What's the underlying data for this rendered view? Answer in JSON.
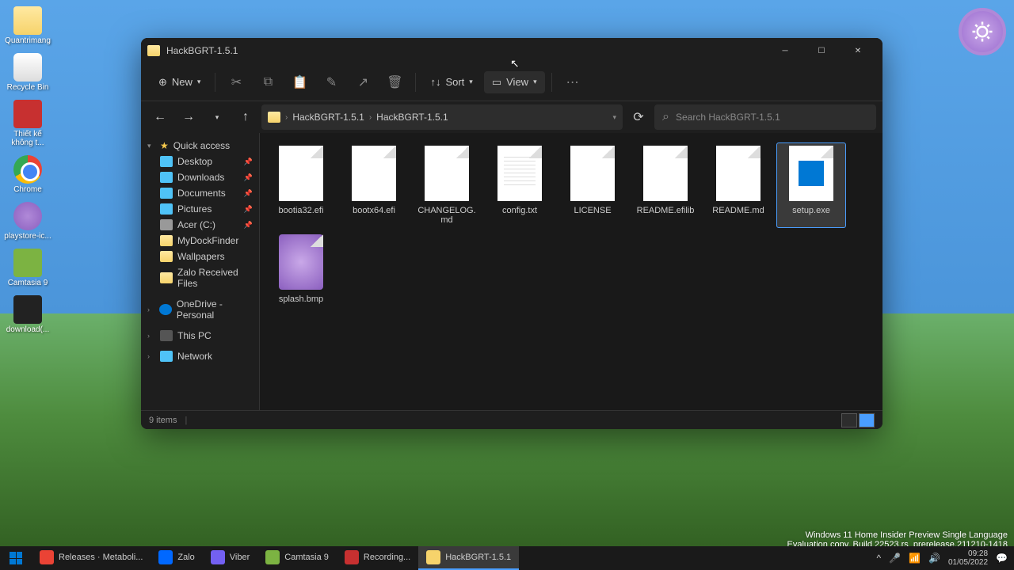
{
  "window": {
    "title": "HackBGRT-1.5.1",
    "toolbar": {
      "new": "New",
      "sort": "Sort",
      "view": "View"
    },
    "breadcrumbs": [
      "HackBGRT-1.5.1",
      "HackBGRT-1.5.1"
    ],
    "search_placeholder": "Search HackBGRT-1.5.1",
    "status": "9 items"
  },
  "sidebar": {
    "quick_access": "Quick access",
    "items": [
      {
        "label": "Desktop",
        "pinned": true
      },
      {
        "label": "Downloads",
        "pinned": true
      },
      {
        "label": "Documents",
        "pinned": true
      },
      {
        "label": "Pictures",
        "pinned": true
      },
      {
        "label": "Acer (C:)",
        "pinned": true
      },
      {
        "label": "MyDockFinder",
        "pinned": false
      },
      {
        "label": "Wallpapers",
        "pinned": false
      },
      {
        "label": "Zalo Received Files",
        "pinned": false
      }
    ],
    "onedrive": "OneDrive - Personal",
    "this_pc": "This PC",
    "network": "Network"
  },
  "files": [
    {
      "name": "bootia32.efi",
      "type": "file"
    },
    {
      "name": "bootx64.efi",
      "type": "file"
    },
    {
      "name": "CHANGELOG.md",
      "type": "file"
    },
    {
      "name": "config.txt",
      "type": "text"
    },
    {
      "name": "LICENSE",
      "type": "file"
    },
    {
      "name": "README.efilib",
      "type": "file"
    },
    {
      "name": "README.md",
      "type": "file"
    },
    {
      "name": "setup.exe",
      "type": "exe",
      "selected": true
    },
    {
      "name": "splash.bmp",
      "type": "bmp"
    }
  ],
  "desktop_icons": [
    {
      "label": "Quantrimang",
      "type": "folder"
    },
    {
      "label": "Recycle Bin",
      "type": "bin"
    },
    {
      "label": "Thiết kế không t...",
      "type": "red"
    },
    {
      "label": "Chrome",
      "type": "chrome"
    },
    {
      "label": "playstore-ic...",
      "type": "purple"
    },
    {
      "label": "Camtasia 9",
      "type": "green"
    },
    {
      "label": "download(...",
      "type": "dark"
    }
  ],
  "taskbar": [
    {
      "label": "Releases · Metaboli...",
      "icon": "chrome"
    },
    {
      "label": "Zalo",
      "icon": "zalo"
    },
    {
      "label": "Viber",
      "icon": "viber"
    },
    {
      "label": "Camtasia 9",
      "icon": "camtasia"
    },
    {
      "label": "Recording...",
      "icon": "rec"
    },
    {
      "label": "HackBGRT-1.5.1",
      "icon": "folder",
      "active": true
    }
  ],
  "watermark": {
    "line1": "Windows 11 Home Insider Preview Single Language",
    "line2": "Evaluation copy. Build 22523.rs_prerelease.211210-1418"
  },
  "clock": {
    "time": "09:28",
    "date": "01/05/2022"
  }
}
